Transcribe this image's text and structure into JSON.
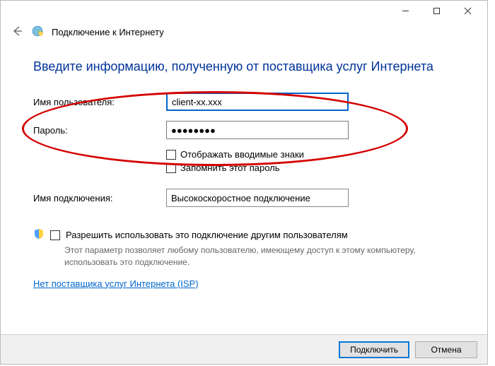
{
  "titlebar": {
    "minimize_name": "minimize-icon",
    "maximize_name": "maximize-icon",
    "close_name": "close-icon"
  },
  "header": {
    "title": "Подключение к Интернету"
  },
  "heading": "Введите информацию, полученную от поставщика услуг Интернета",
  "fields": {
    "username": {
      "label": "Имя пользователя:",
      "value": "client-xx.xxx"
    },
    "password": {
      "label": "Пароль:",
      "value": "●●●●●●●●"
    },
    "connection": {
      "label": "Имя подключения:",
      "value": "Высокоскоростное подключение"
    }
  },
  "checks": {
    "show_chars": "Отображать вводимые знаки",
    "remember": "Запомнить этот пароль"
  },
  "permission": {
    "label": "Разрешить использовать это подключение другим пользователям",
    "desc": "Этот параметр позволяет любому пользователю, имеющему доступ к этому компьютеру, использовать это подключение."
  },
  "link": "Нет поставщика услуг Интернета (ISP)",
  "buttons": {
    "connect": "Подключить",
    "cancel": "Отмена"
  }
}
